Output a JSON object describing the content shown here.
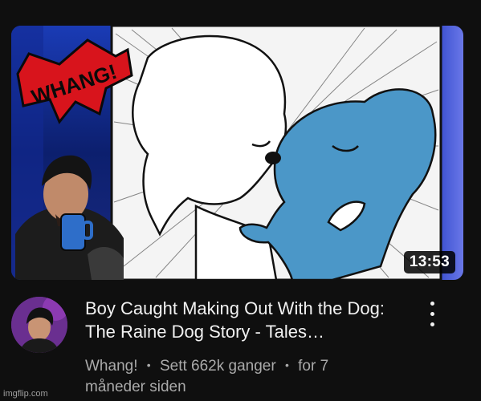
{
  "video": {
    "duration": "13:53",
    "logo_text": "WHANG!",
    "title": "Boy Caught Making Out With the Dog: The Raine Dog Story - Tales…",
    "channel": "Whang!",
    "views": "Sett 662k ganger",
    "age": "for 7 måneder siden",
    "separator": "•"
  },
  "watermark": "imgflip.com",
  "colors": {
    "background": "#0f0f0f",
    "title": "#f1f1f1",
    "meta": "#aaaaaa",
    "logo_red": "#d8141c",
    "dog_blue": "#4b97c8"
  },
  "icons": {
    "more": "vertical-ellipsis-icon"
  }
}
